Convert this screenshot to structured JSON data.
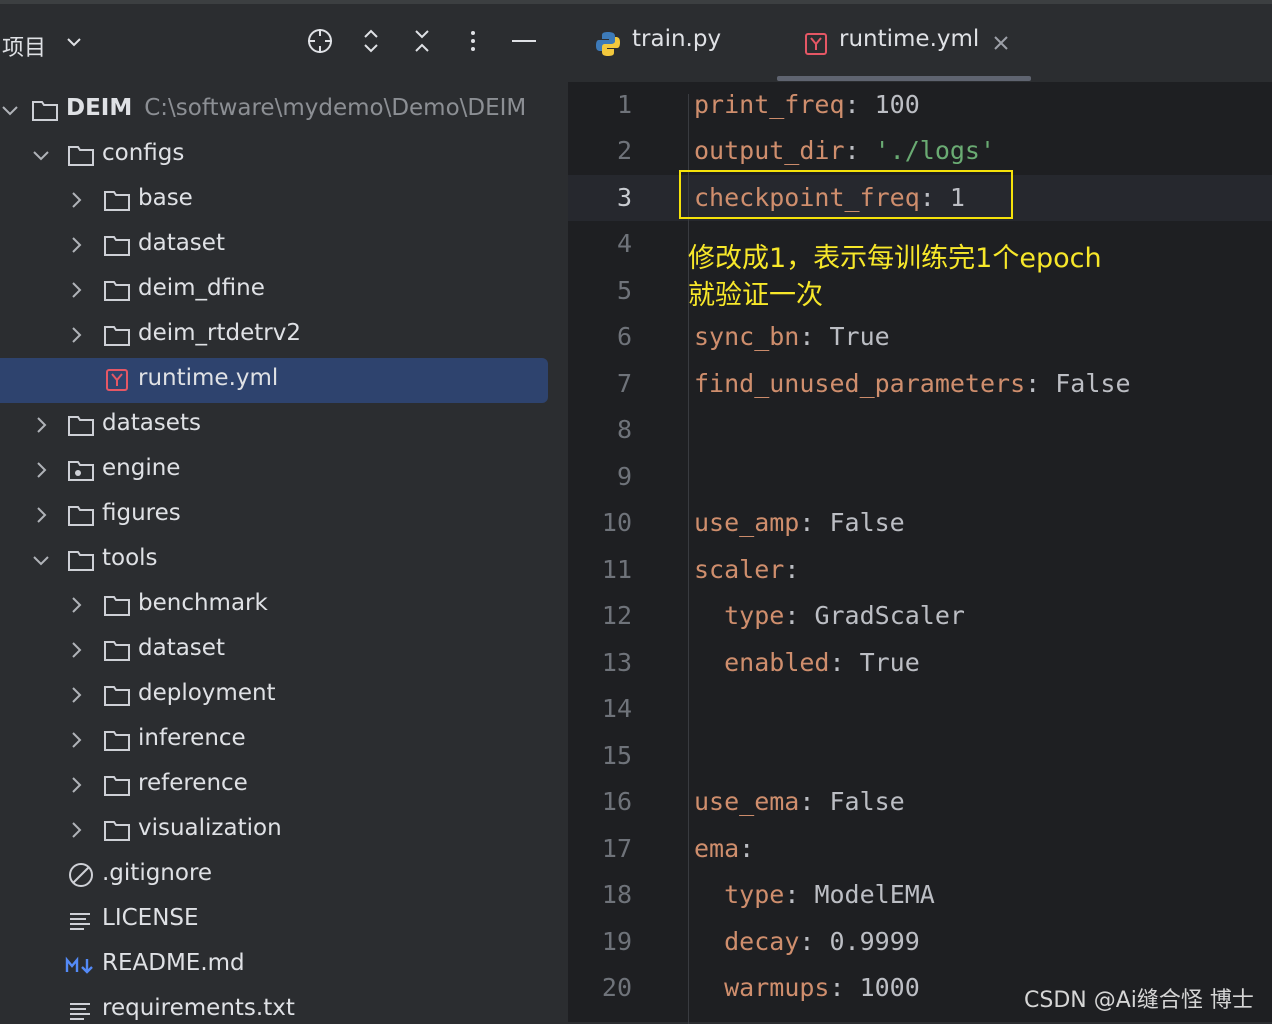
{
  "project_panel": {
    "title": "项目",
    "tree": [
      {
        "label": "DEIM",
        "path": "C:\\software\\mydemo\\Demo\\DEIM"
      },
      {
        "label": "configs"
      },
      {
        "label": "base"
      },
      {
        "label": "dataset"
      },
      {
        "label": "deim_dfine"
      },
      {
        "label": "deim_rtdetrv2"
      },
      {
        "label": "runtime.yml"
      },
      {
        "label": "datasets"
      },
      {
        "label": "engine"
      },
      {
        "label": "figures"
      },
      {
        "label": "tools"
      },
      {
        "label": "benchmark"
      },
      {
        "label": "dataset"
      },
      {
        "label": "deployment"
      },
      {
        "label": "inference"
      },
      {
        "label": "reference"
      },
      {
        "label": "visualization"
      },
      {
        "label": ".gitignore"
      },
      {
        "label": "LICENSE"
      },
      {
        "label": "README.md"
      },
      {
        "label": "requirements.txt"
      }
    ]
  },
  "editor": {
    "tabs": [
      {
        "label": "train.py"
      },
      {
        "label": "runtime.yml"
      }
    ],
    "current_line": 3,
    "line_numbers": [
      "1",
      "2",
      "3",
      "4",
      "5",
      "6",
      "7",
      "8",
      "9",
      "10",
      "11",
      "12",
      "13",
      "14",
      "15",
      "16",
      "17",
      "18",
      "19",
      "20"
    ],
    "code": {
      "l1": {
        "key": "print_freq",
        "sep": ": ",
        "val": "100"
      },
      "l2": {
        "key": "output_dir",
        "sep": ": ",
        "val": "'./logs'"
      },
      "l3": {
        "key": "checkpoint_freq",
        "sep": ": ",
        "val": "1"
      },
      "l6": {
        "key": "sync_bn",
        "sep": ": ",
        "val": "True"
      },
      "l7": {
        "key": "find_unused_parameters",
        "sep": ": ",
        "val": "False"
      },
      "l10": {
        "key": "use_amp",
        "sep": ": ",
        "val": "False"
      },
      "l11": {
        "key": "scaler",
        "sep": ":"
      },
      "l12": {
        "indent": "  ",
        "key": "type",
        "sep": ": ",
        "val": "GradScaler"
      },
      "l13": {
        "indent": "  ",
        "key": "enabled",
        "sep": ": ",
        "val": "True"
      },
      "l16": {
        "key": "use_ema",
        "sep": ": ",
        "val": "False"
      },
      "l17": {
        "key": "ema",
        "sep": ":"
      },
      "l18": {
        "indent": "  ",
        "key": "type",
        "sep": ": ",
        "val": "ModelEMA"
      },
      "l19": {
        "indent": "  ",
        "key": "decay",
        "sep": ": ",
        "val": "0.9999"
      },
      "l20": {
        "indent": "  ",
        "key": "warmups",
        "sep": ": ",
        "val": "1000"
      }
    }
  },
  "annotation": {
    "line1": "修改成1，表示每训练完1个epoch",
    "line2": "就验证一次"
  },
  "watermark": "CSDN @Ai缝合怪 博士",
  "colors": {
    "selection": "#2e436e",
    "annotation": "#f7e72a",
    "yaml_key": "#cf8e6d",
    "yaml_string": "#6aab73"
  }
}
